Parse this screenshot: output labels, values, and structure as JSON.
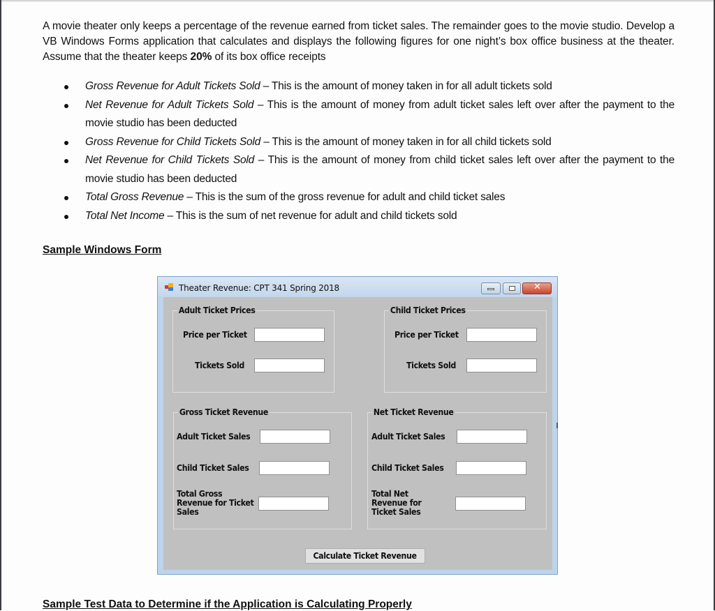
{
  "document": {
    "intro": {
      "text_before_bold": "A movie theater only keeps a percentage of the revenue earned from ticket sales. The remainder goes to the movie studio. Develop a VB Windows Forms application that calculates and displays the following figures for one night’s box office business at the theater. Assume that the theater keeps ",
      "bold": "20%",
      "text_after_bold": " of its box office receipts"
    },
    "bullets": [
      {
        "term": "Gross Revenue for Adult Tickets Sold",
        "description": " – This is the amount of money taken in for all adult tickets sold"
      },
      {
        "term": "Net Revenue for Adult Tickets Sold",
        "description": " – This is the amount of money from adult ticket sales left over after the payment to the movie studio has been deducted"
      },
      {
        "term": "Gross Revenue for Child Tickets Sold",
        "description": " – This is the amount of money taken in for all child tickets sold"
      },
      {
        "term": "Net Revenue for Child  Tickets Sold",
        "description": " – This is the amount of money from child ticket sales left over after the payment to the movie studio has been deducted"
      },
      {
        "term": "Total Gross Revenue",
        "description": " – This is the sum of the gross revenue for adult and child ticket sales"
      },
      {
        "term": "Total Net Income",
        "description": " – This is the sum of net revenue for adult and child tickets sold"
      }
    ],
    "sample_form_heading": "Sample Windows Form",
    "sample_test_heading": "Sample Test Data to Determine if the Application is Calculating Properly"
  },
  "form": {
    "title": "Theater Revenue: CPT 341 Spring 2018",
    "adult_group": {
      "title": "Adult Ticket Prices",
      "price_label": "Price per Ticket",
      "price_value": "",
      "sold_label": "Tickets Sold",
      "sold_value": ""
    },
    "child_group": {
      "title": "Child Ticket Prices",
      "price_label": "Price per Ticket",
      "price_value": "",
      "sold_label": "Tickets Sold",
      "sold_value": ""
    },
    "gross_group": {
      "title": "Gross Ticket Revenue",
      "adult_label": "Adult Ticket Sales",
      "adult_value": "",
      "child_label": "Child Ticket Sales",
      "child_value": "",
      "total_label_lines": [
        "Total Gross",
        "Revenue for Ticket",
        "Sales"
      ],
      "total_value": ""
    },
    "net_group": {
      "title": "Net Ticket Revenue",
      "adult_label": "Adult Ticket Sales",
      "adult_value": "",
      "child_label": "Child Ticket Sales",
      "child_value": "",
      "total_label_lines": [
        "Total Net",
        "Revenue for",
        "Ticket Sales"
      ],
      "total_value": ""
    },
    "calculate_button": "Calculate Ticket Revenue",
    "colors": {
      "form_background": "#c0c0c0",
      "close_button": "#c9462e"
    }
  }
}
